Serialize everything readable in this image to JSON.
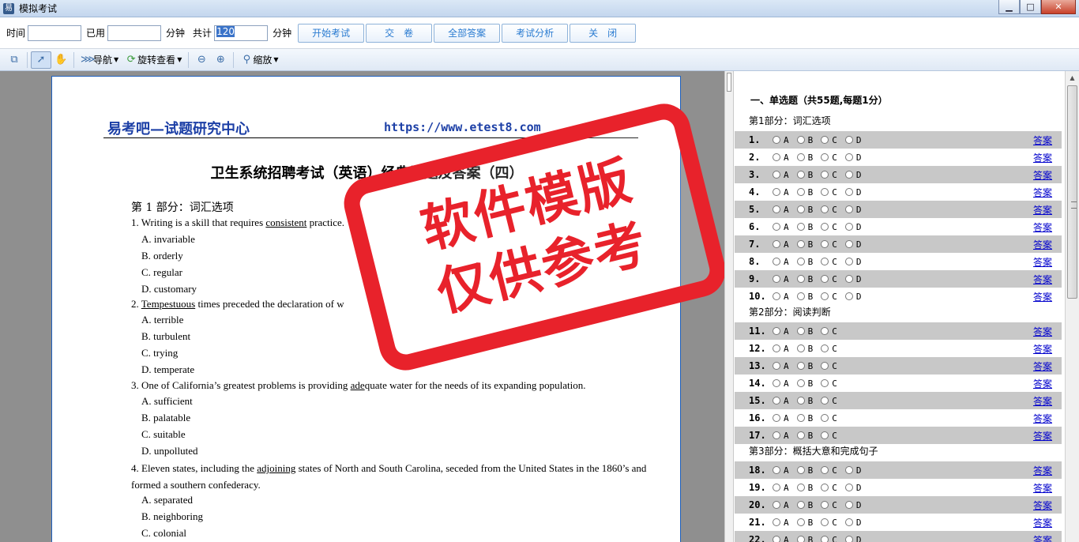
{
  "window": {
    "title": "模拟考试",
    "app_icon": "易",
    "minimize": "▁",
    "maximize": "□",
    "close": "✕"
  },
  "exam_toolbar": {
    "time_label": "时间",
    "used_label": "已用",
    "minutes_label_1": "分钟",
    "total_label": "共计",
    "total_value": "120",
    "minutes_label_2": "分钟",
    "buttons": [
      "开始考试",
      "交　卷",
      "全部答案",
      "考试分析",
      "关　闭"
    ]
  },
  "view_toolbar": {
    "navigate": "导航",
    "rotate": "旋转查看",
    "zoom": "缩放"
  },
  "document": {
    "header_left": "易考吧—试题研究中心",
    "header_right": "https://www.etest8.com",
    "title": "卫生系统招聘考试（英语）经典试题及答案（四）",
    "section": "第 1 部分：词汇选项",
    "questions": [
      {
        "pre": "1. Writing is a skill that requires ",
        "word": "consistent",
        "post": " practice.",
        "options": [
          "A. invariable",
          "B. orderly",
          "C. regular",
          "D. customary"
        ]
      },
      {
        "pre": "2. ",
        "word": "Tempestuous",
        "post": " times preceded the declaration of w",
        "options": [
          "A. terrible",
          "B. turbulent",
          "C. trying",
          "D. temperate"
        ]
      },
      {
        "pre": "3. One of California’s greatest problems is providing ",
        "word": "ade",
        "post": "quate water for the needs of its expanding population.",
        "options": [
          "A. sufficient",
          "B. palatable",
          "C. suitable",
          "D. unpolluted"
        ]
      },
      {
        "pre": "4. Eleven states, including the ",
        "word": "adjoining",
        "post": " states of North and South Carolina, seceded from the United States in the 1860’s and formed a southern confederacy.",
        "options": [
          "A. separated",
          "B. neighboring",
          "C. colonial"
        ]
      }
    ]
  },
  "watermark": {
    "line1": "软件模版",
    "line2": "仅供参考"
  },
  "answer_panel": {
    "heading": "一、单选题（共55题,每题1分）",
    "answer_link": "答案",
    "parts": [
      {
        "title": "第1部分：词汇选项",
        "items": [
          "1.",
          "2.",
          "3.",
          "4.",
          "5.",
          "6.",
          "7.",
          "8.",
          "9.",
          "10."
        ],
        "options": [
          "A",
          "B",
          "C",
          "D"
        ]
      },
      {
        "title": "第2部分：阅读判断",
        "items": [
          "11.",
          "12.",
          "13.",
          "14.",
          "15.",
          "16.",
          "17."
        ],
        "options": [
          "A",
          "B",
          "C"
        ]
      },
      {
        "title": "第3部分：概括大意和完成句子",
        "items": [
          "18.",
          "19.",
          "20.",
          "21.",
          "22."
        ],
        "options": [
          "A",
          "B",
          "C",
          "D"
        ]
      }
    ]
  }
}
